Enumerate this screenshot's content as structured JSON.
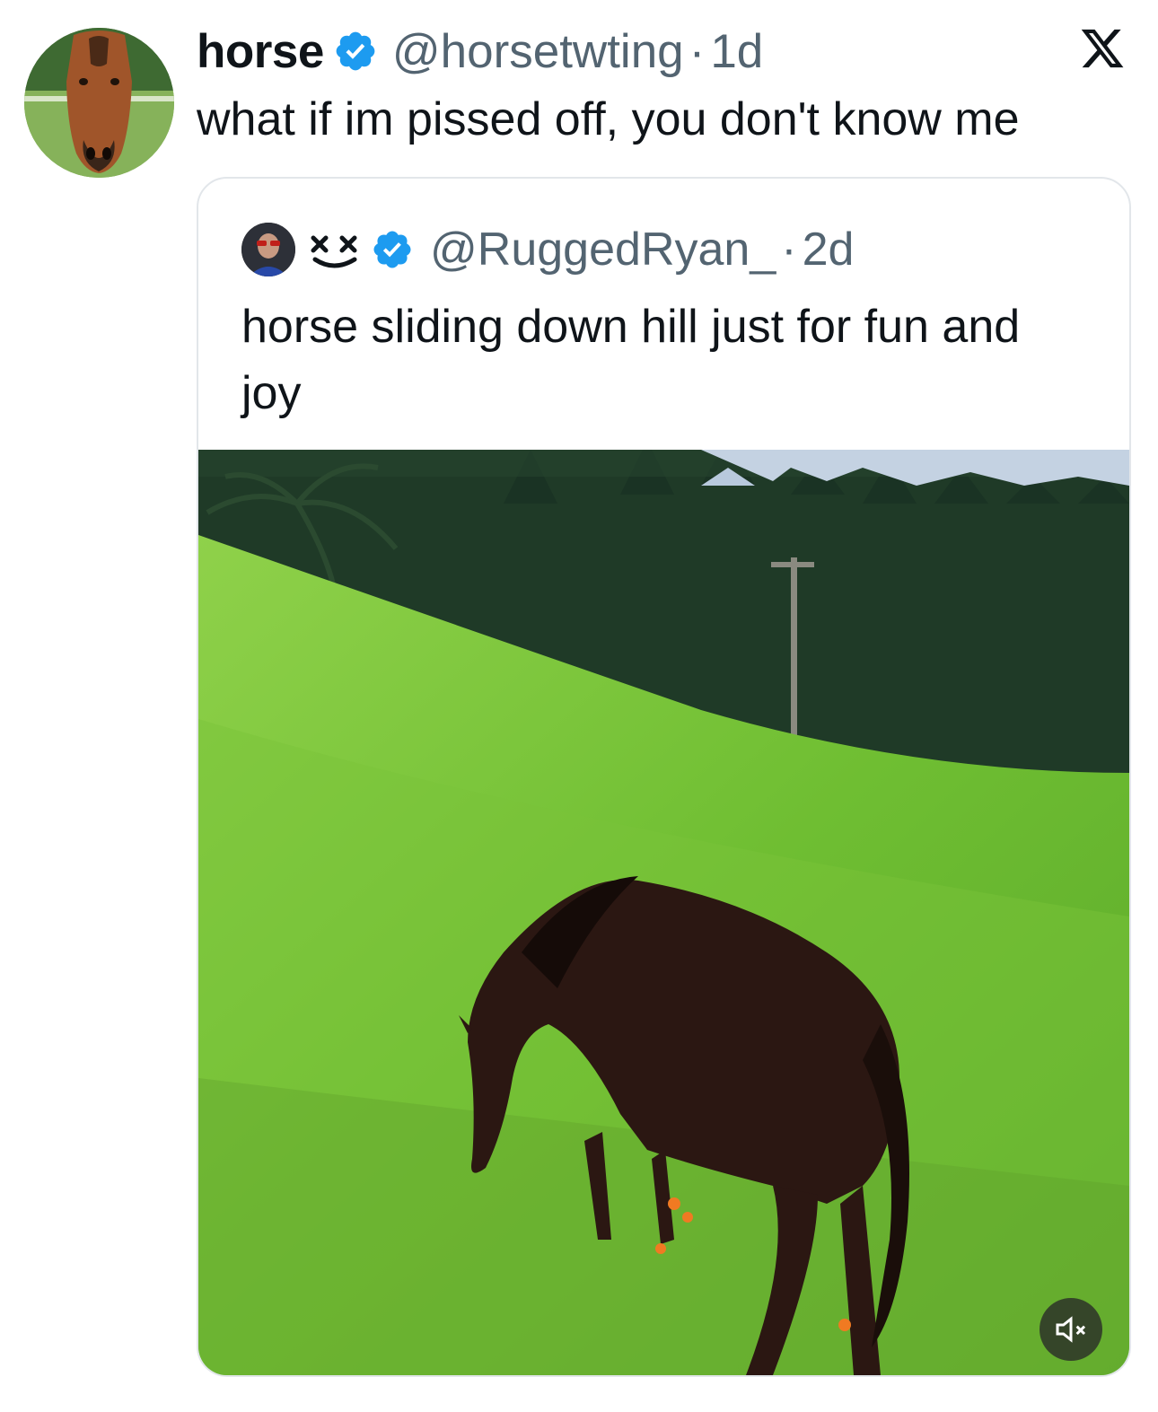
{
  "tweet": {
    "author_name": "horse",
    "author_handle": "@horsetwting",
    "time": "1d",
    "text": "what if im pissed off, you don't know me",
    "avatar_icon": "horse-avatar-icon",
    "verified_icon": "verified-badge-icon"
  },
  "quoted": {
    "author_handle": "@RuggedRyan_",
    "time": "2d",
    "text": "horse sliding down hill just for fun and joy",
    "name_icon": "xx-smiley-icon",
    "media_description_icon": "video-thumbnail-icon",
    "mute_icon": "muted-speaker-icon"
  },
  "separator": "·",
  "colors": {
    "verified": "#1d9bf0",
    "secondary_text": "#536471",
    "primary_text": "#0f1419",
    "border": "#e2e6ea"
  }
}
